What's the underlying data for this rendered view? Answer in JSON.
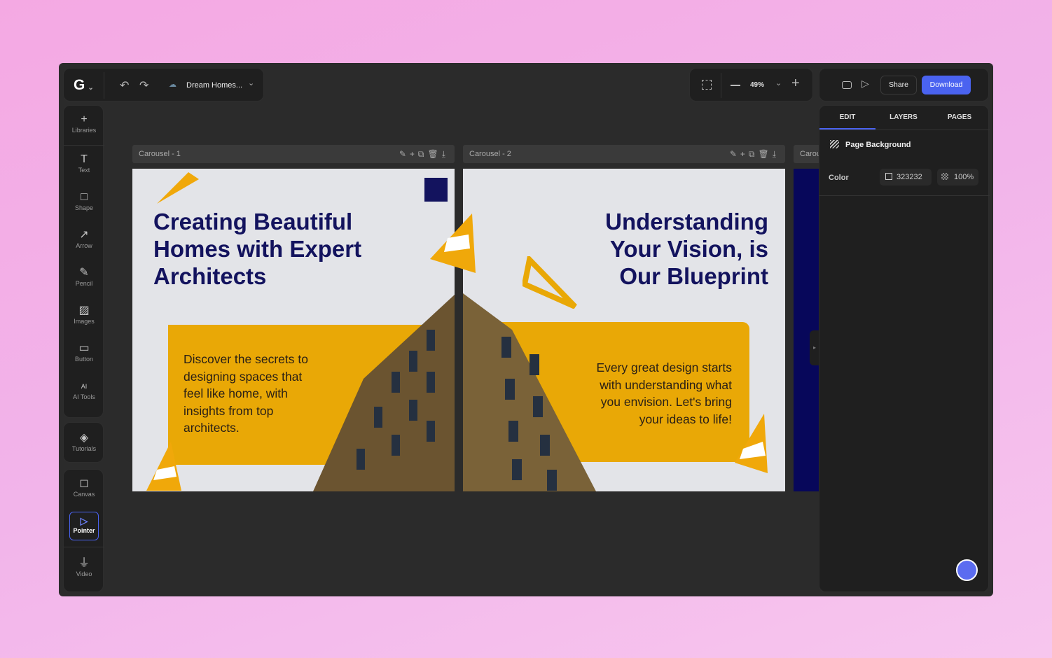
{
  "header": {
    "logo": "G",
    "undo_icon": "undo-icon",
    "redo_icon": "redo-icon",
    "project_name": "Dream Homes...",
    "zoom": "49%",
    "share": "Share",
    "download": "Download"
  },
  "tools": [
    {
      "label": "Libraries",
      "icon": "+"
    },
    {
      "label": "Text",
      "icon": "T"
    },
    {
      "label": "Shape",
      "icon": "□"
    },
    {
      "label": "Arrow",
      "icon": "↗"
    },
    {
      "label": "Pencil",
      "icon": "✎"
    },
    {
      "label": "Images",
      "icon": "▨"
    },
    {
      "label": "Button",
      "icon": "▭"
    },
    {
      "label": "AI Tools",
      "icon": "AI"
    }
  ],
  "tutorials": "Tutorials",
  "canvas": "Canvas",
  "pointer": "Pointer",
  "video": "Video",
  "slides": [
    {
      "label": "Carousel - 1",
      "title": [
        "Creating Beautiful",
        "Homes with Expert",
        "Architects"
      ],
      "body": [
        "Discover the secrets to",
        "designing spaces that",
        "feel like home, with",
        "insights from top",
        "architects."
      ]
    },
    {
      "label": "Carousel - 2",
      "title": [
        "Understanding",
        "Your Vision, is",
        "Our Blueprint"
      ],
      "body": [
        "Every great design starts",
        "with understanding what",
        "you envision. Let's bring",
        "your ideas to life!"
      ]
    },
    {
      "label": "Carou"
    }
  ],
  "right_panel": {
    "tabs": [
      "EDIT",
      "LAYERS",
      "PAGES"
    ],
    "active_tab": "EDIT",
    "section": "Page Background",
    "color_label": "Color",
    "color_value": "323232",
    "opacity": "100%"
  },
  "colors": {
    "accent": "#4a63f0",
    "navy": "#13135e",
    "yellow": "#e9a806",
    "canvas": "#323232"
  }
}
